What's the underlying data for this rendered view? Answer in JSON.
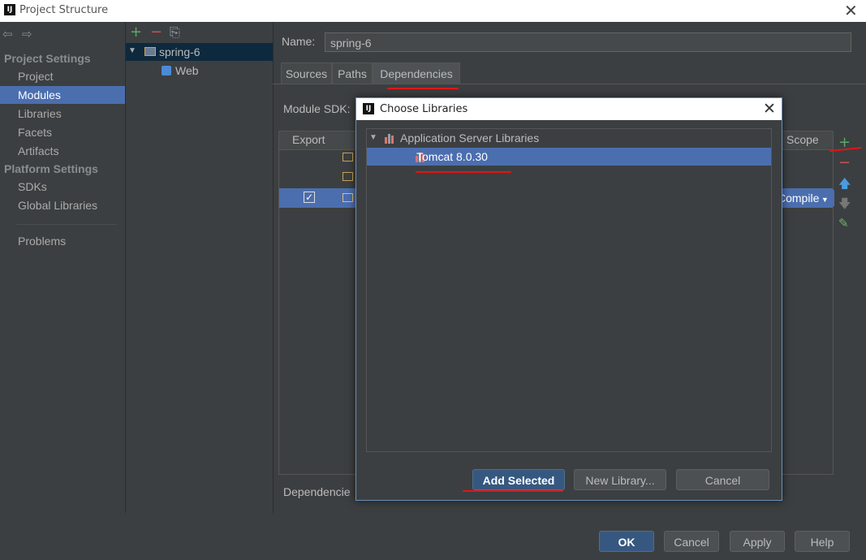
{
  "window": {
    "title": "Project Structure",
    "close_glyph": "✕",
    "logo_text": "IJ"
  },
  "sidebar": {
    "back_glyph": "⇦",
    "forward_glyph": "⇨",
    "project_settings_header": "Project Settings",
    "project_items": [
      "Project",
      "Modules",
      "Libraries",
      "Facets",
      "Artifacts"
    ],
    "platform_settings_header": "Platform Settings",
    "platform_items": [
      "SDKs",
      "Global Libraries"
    ],
    "problems": "Problems",
    "selected_item": "Modules"
  },
  "tree_panel": {
    "add_glyph": "+",
    "remove_glyph": "−",
    "copy_glyph": "⎘",
    "module_name": "spring-6",
    "facet_name": "Web"
  },
  "content": {
    "name_label": "Name:",
    "name_value": "spring-6",
    "tabs": [
      "Sources",
      "Paths",
      "Dependencies"
    ],
    "active_tab": "Dependencies",
    "module_sdk_label": "Module SDK:",
    "export_header": "Export",
    "scope_header": "Scope",
    "scope_value": "Compile",
    "dependencies_storage_label": "Dependencie"
  },
  "buttons": {
    "ok": "OK",
    "cancel": "Cancel",
    "apply": "Apply",
    "help": "Help"
  },
  "dialog": {
    "title": "Choose Libraries",
    "close_glyph": "✕",
    "logo_text": "IJ",
    "group_label": "Application Server Libraries",
    "library_item": "Tomcat 8.0.30",
    "add_selected": "Add Selected",
    "new_library": "New Library...",
    "cancel": "Cancel"
  },
  "colors": {
    "background": "#3c3f41",
    "selection": "#4b6eaf",
    "default_button": "#365880",
    "add_green": "#59a869",
    "remove_red": "#c75450",
    "annotation_red": "#e01616"
  }
}
